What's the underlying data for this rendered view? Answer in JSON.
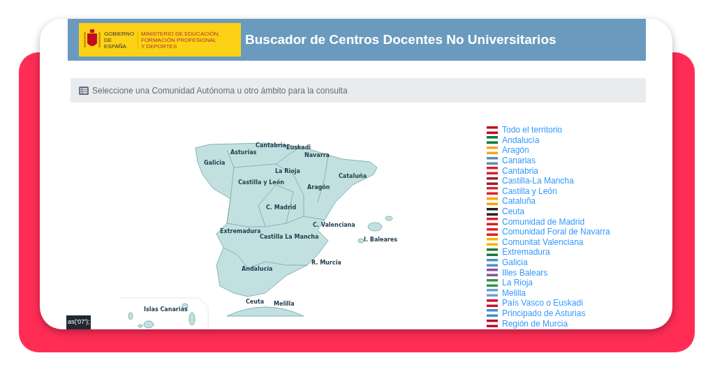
{
  "header": {
    "logo_left": "GOBIERNO DE ESPAÑA",
    "logo_right": "MINISTERIO DE EDUCACIÓN, FORMACIÓN PROFESIONAL Y DEPORTES",
    "title": "Buscador de Centros Docentes No Universitarios"
  },
  "prompt": "Seleccione una Comunidad Autónoma u otro ámbito para la consulta",
  "map_labels": [
    {
      "text": "Cantabria"
    },
    {
      "text": "Euskadi"
    },
    {
      "text": "Asturias"
    },
    {
      "text": "Navarra"
    },
    {
      "text": "Galicia"
    },
    {
      "text": "La Rioja"
    },
    {
      "text": "Cataluña"
    },
    {
      "text": "Castilla y León"
    },
    {
      "text": "Aragón"
    },
    {
      "text": "C. Madrid"
    },
    {
      "text": "C. Valenciana"
    },
    {
      "text": "Extremadura"
    },
    {
      "text": "Castilla La Mancha"
    },
    {
      "text": "I. Baleares"
    },
    {
      "text": "R. Murcia"
    },
    {
      "text": "Andalucía"
    },
    {
      "text": "Ceuta"
    },
    {
      "text": "Melilla"
    },
    {
      "text": "Islas Canarias"
    }
  ],
  "regions": [
    {
      "name": "Todo el territorio",
      "color": "#c60b1e"
    },
    {
      "name": "Andalucía",
      "color": "#007a3d"
    },
    {
      "name": "Aragón",
      "color": "#f5a623"
    },
    {
      "name": "Canarias",
      "color": "#5b8fb9"
    },
    {
      "name": "Cantabria",
      "color": "#d8202f"
    },
    {
      "name": "Castilla-La Mancha",
      "color": "#9b1b30"
    },
    {
      "name": "Castilla y León",
      "color": "#e0202a"
    },
    {
      "name": "Cataluña",
      "color": "#f7a600"
    },
    {
      "name": "Ceuta",
      "color": "#222222"
    },
    {
      "name": "Comunidad de Madrid",
      "color": "#d3202f"
    },
    {
      "name": "Comunidad Foral de Navarra",
      "color": "#e02020"
    },
    {
      "name": "Comunitat Valenciana",
      "color": "#f5b400"
    },
    {
      "name": "Extremadura",
      "color": "#1a7a3a"
    },
    {
      "name": "Galicia",
      "color": "#4a90c8"
    },
    {
      "name": "Illes Balears",
      "color": "#8a4fa0"
    },
    {
      "name": "La Rioja",
      "color": "#2e9a3e"
    },
    {
      "name": "Melilla",
      "color": "#6a9fd8"
    },
    {
      "name": "País Vasco o Euskadi",
      "color": "#d0102a"
    },
    {
      "name": "Principado de Asturias",
      "color": "#3a8fd8"
    },
    {
      "name": "Región de Murcia",
      "color": "#b01030"
    }
  ],
  "tooltip": "as('07');"
}
